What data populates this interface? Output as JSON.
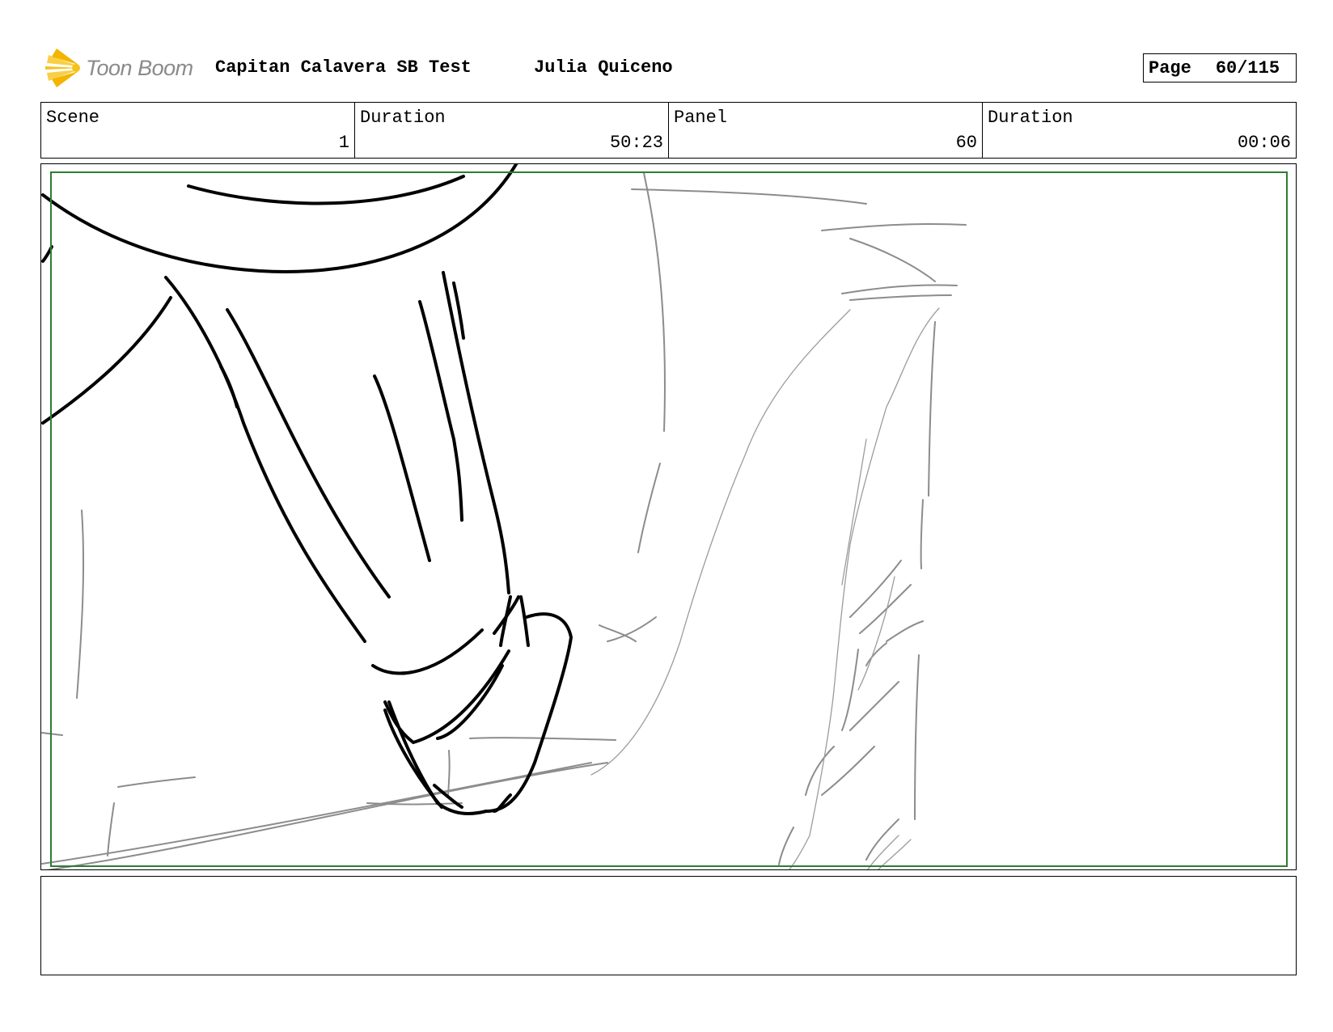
{
  "header": {
    "logo_text": "Toon Boom",
    "project_title": "Capitan Calavera SB Test",
    "author": "Julia Quiceno",
    "page_label": "Page",
    "page_value": "60/115"
  },
  "info": {
    "scene_label": "Scene",
    "scene_value": "1",
    "scene_duration_label": "Duration",
    "scene_duration_value": "50:23",
    "panel_label": "Panel",
    "panel_value": "60",
    "panel_duration_label": "Duration",
    "panel_duration_value": "00:06"
  },
  "colors": {
    "safe_frame": "#2e7d32",
    "sketch_dark": "#000000",
    "sketch_light": "#8c8c8c",
    "logo_yellow": "#f6c218"
  },
  "icons": {
    "logo": "toon-boom-logo-icon"
  }
}
